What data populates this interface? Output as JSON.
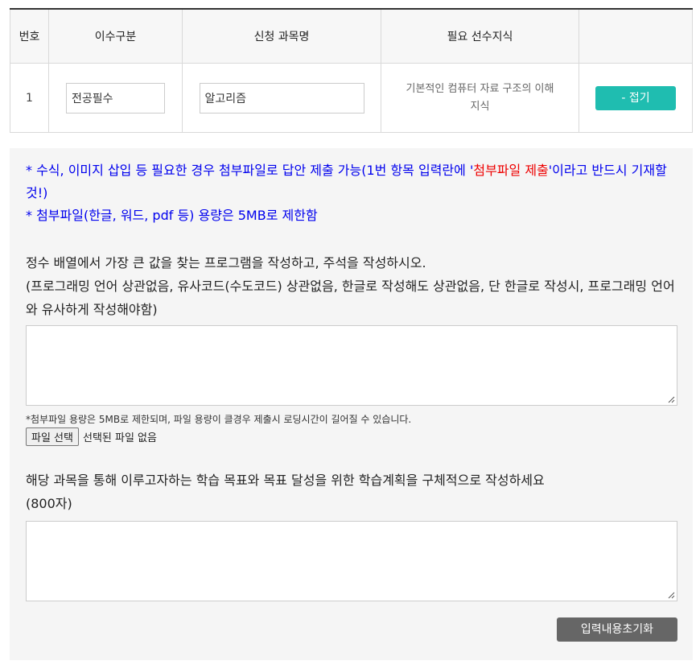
{
  "table": {
    "headers": [
      "번호",
      "이수구분",
      "신청 과목명",
      "필요 선수지식",
      ""
    ],
    "row": {
      "number": "1",
      "category_value": "전공필수",
      "course_value": "알고리즘",
      "prereq_line1": "기본적인 컴퓨터 자료 구조의 이해",
      "prereq_line2": "지식",
      "collapse_label": "- 접기"
    }
  },
  "notice": {
    "line1_pre": "* 수식, 이미지 삽입 등 필요한 경우 첨부파일로 답안 제출 가능(1번 항목 입력란에 '",
    "line1_red": "첨부파일 제출",
    "line1_post": "'이라고 반드시 기재할 것!)",
    "line2": "* 첨부파일(한글, 워드, pdf 등) 용량은 5MB로 제한함"
  },
  "question1": {
    "line1": "정수 배열에서 가장 큰 값을 찾는 프로그램을 작성하고, 주석을 작성하시오.",
    "line2": "(프로그래밍 언어 상관없음, 유사코드(수도코드) 상관없음, 한글로 작성해도 상관없음, 단 한글로 작성시, 프로그래밍 언어와 유사하게 작성해야함)"
  },
  "file": {
    "note": "*첨부파일 용량은 5MB로 제한되며, 파일 용량이 클경우 제출시 로딩시간이 길어질 수 있습니다.",
    "button": "파일 선택",
    "status": "선택된 파일 없음"
  },
  "question2": {
    "line1": "해당 과목을 통해 이루고자하는 학습 목표와 목표 달성을 위한 학습계획을 구체적으로 작성하세요",
    "line2": "(800자)"
  },
  "reset_label": "입력내용초기화",
  "colors": {
    "accent": "#1fbdb0",
    "notice_blue": "#0000ee",
    "notice_red": "#ee0000"
  }
}
